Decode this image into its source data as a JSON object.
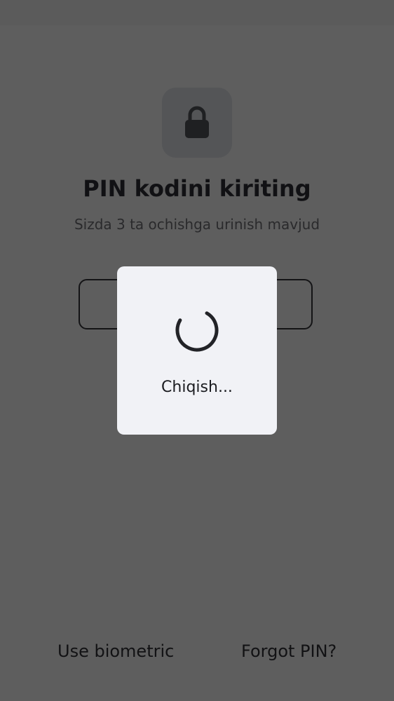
{
  "screen": {
    "title": "PIN kodini kiriting",
    "subtitle": "Sizda 3 ta ochishga urinish mavjud",
    "lock_icon": "lock-icon",
    "use_biometric_label": "Use biometric",
    "forgot_pin_label": "Forgot PIN?"
  },
  "dialog": {
    "message": "Chiqish...",
    "spinner_icon": "progress-spinner-icon"
  },
  "colors": {
    "scrim_background": "#5e5e5e",
    "dialog_background": "#f1f2f6",
    "text_dark": "#111114"
  }
}
